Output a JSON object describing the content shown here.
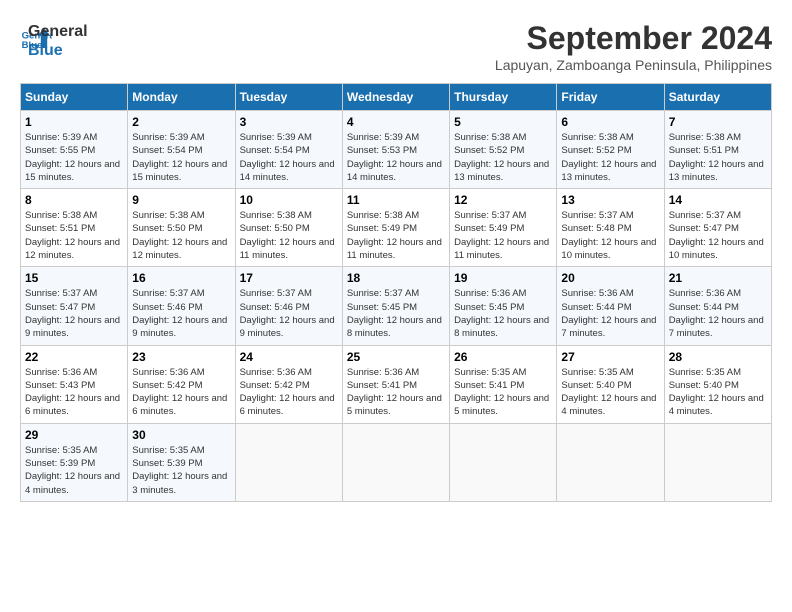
{
  "header": {
    "logo_line1": "General",
    "logo_line2": "Blue",
    "month_title": "September 2024",
    "location": "Lapuyan, Zamboanga Peninsula, Philippines"
  },
  "days_of_week": [
    "Sunday",
    "Monday",
    "Tuesday",
    "Wednesday",
    "Thursday",
    "Friday",
    "Saturday"
  ],
  "weeks": [
    [
      {
        "num": "1",
        "sunrise": "5:39 AM",
        "sunset": "5:55 PM",
        "daylight": "12 hours and 15 minutes."
      },
      {
        "num": "2",
        "sunrise": "5:39 AM",
        "sunset": "5:54 PM",
        "daylight": "12 hours and 15 minutes."
      },
      {
        "num": "3",
        "sunrise": "5:39 AM",
        "sunset": "5:54 PM",
        "daylight": "12 hours and 14 minutes."
      },
      {
        "num": "4",
        "sunrise": "5:39 AM",
        "sunset": "5:53 PM",
        "daylight": "12 hours and 14 minutes."
      },
      {
        "num": "5",
        "sunrise": "5:38 AM",
        "sunset": "5:52 PM",
        "daylight": "12 hours and 13 minutes."
      },
      {
        "num": "6",
        "sunrise": "5:38 AM",
        "sunset": "5:52 PM",
        "daylight": "12 hours and 13 minutes."
      },
      {
        "num": "7",
        "sunrise": "5:38 AM",
        "sunset": "5:51 PM",
        "daylight": "12 hours and 13 minutes."
      }
    ],
    [
      {
        "num": "8",
        "sunrise": "5:38 AM",
        "sunset": "5:51 PM",
        "daylight": "12 hours and 12 minutes."
      },
      {
        "num": "9",
        "sunrise": "5:38 AM",
        "sunset": "5:50 PM",
        "daylight": "12 hours and 12 minutes."
      },
      {
        "num": "10",
        "sunrise": "5:38 AM",
        "sunset": "5:50 PM",
        "daylight": "12 hours and 11 minutes."
      },
      {
        "num": "11",
        "sunrise": "5:38 AM",
        "sunset": "5:49 PM",
        "daylight": "12 hours and 11 minutes."
      },
      {
        "num": "12",
        "sunrise": "5:37 AM",
        "sunset": "5:49 PM",
        "daylight": "12 hours and 11 minutes."
      },
      {
        "num": "13",
        "sunrise": "5:37 AM",
        "sunset": "5:48 PM",
        "daylight": "12 hours and 10 minutes."
      },
      {
        "num": "14",
        "sunrise": "5:37 AM",
        "sunset": "5:47 PM",
        "daylight": "12 hours and 10 minutes."
      }
    ],
    [
      {
        "num": "15",
        "sunrise": "5:37 AM",
        "sunset": "5:47 PM",
        "daylight": "12 hours and 9 minutes."
      },
      {
        "num": "16",
        "sunrise": "5:37 AM",
        "sunset": "5:46 PM",
        "daylight": "12 hours and 9 minutes."
      },
      {
        "num": "17",
        "sunrise": "5:37 AM",
        "sunset": "5:46 PM",
        "daylight": "12 hours and 9 minutes."
      },
      {
        "num": "18",
        "sunrise": "5:37 AM",
        "sunset": "5:45 PM",
        "daylight": "12 hours and 8 minutes."
      },
      {
        "num": "19",
        "sunrise": "5:36 AM",
        "sunset": "5:45 PM",
        "daylight": "12 hours and 8 minutes."
      },
      {
        "num": "20",
        "sunrise": "5:36 AM",
        "sunset": "5:44 PM",
        "daylight": "12 hours and 7 minutes."
      },
      {
        "num": "21",
        "sunrise": "5:36 AM",
        "sunset": "5:44 PM",
        "daylight": "12 hours and 7 minutes."
      }
    ],
    [
      {
        "num": "22",
        "sunrise": "5:36 AM",
        "sunset": "5:43 PM",
        "daylight": "12 hours and 6 minutes."
      },
      {
        "num": "23",
        "sunrise": "5:36 AM",
        "sunset": "5:42 PM",
        "daylight": "12 hours and 6 minutes."
      },
      {
        "num": "24",
        "sunrise": "5:36 AM",
        "sunset": "5:42 PM",
        "daylight": "12 hours and 6 minutes."
      },
      {
        "num": "25",
        "sunrise": "5:36 AM",
        "sunset": "5:41 PM",
        "daylight": "12 hours and 5 minutes."
      },
      {
        "num": "26",
        "sunrise": "5:35 AM",
        "sunset": "5:41 PM",
        "daylight": "12 hours and 5 minutes."
      },
      {
        "num": "27",
        "sunrise": "5:35 AM",
        "sunset": "5:40 PM",
        "daylight": "12 hours and 4 minutes."
      },
      {
        "num": "28",
        "sunrise": "5:35 AM",
        "sunset": "5:40 PM",
        "daylight": "12 hours and 4 minutes."
      }
    ],
    [
      {
        "num": "29",
        "sunrise": "5:35 AM",
        "sunset": "5:39 PM",
        "daylight": "12 hours and 4 minutes."
      },
      {
        "num": "30",
        "sunrise": "5:35 AM",
        "sunset": "5:39 PM",
        "daylight": "12 hours and 3 minutes."
      },
      null,
      null,
      null,
      null,
      null
    ]
  ]
}
